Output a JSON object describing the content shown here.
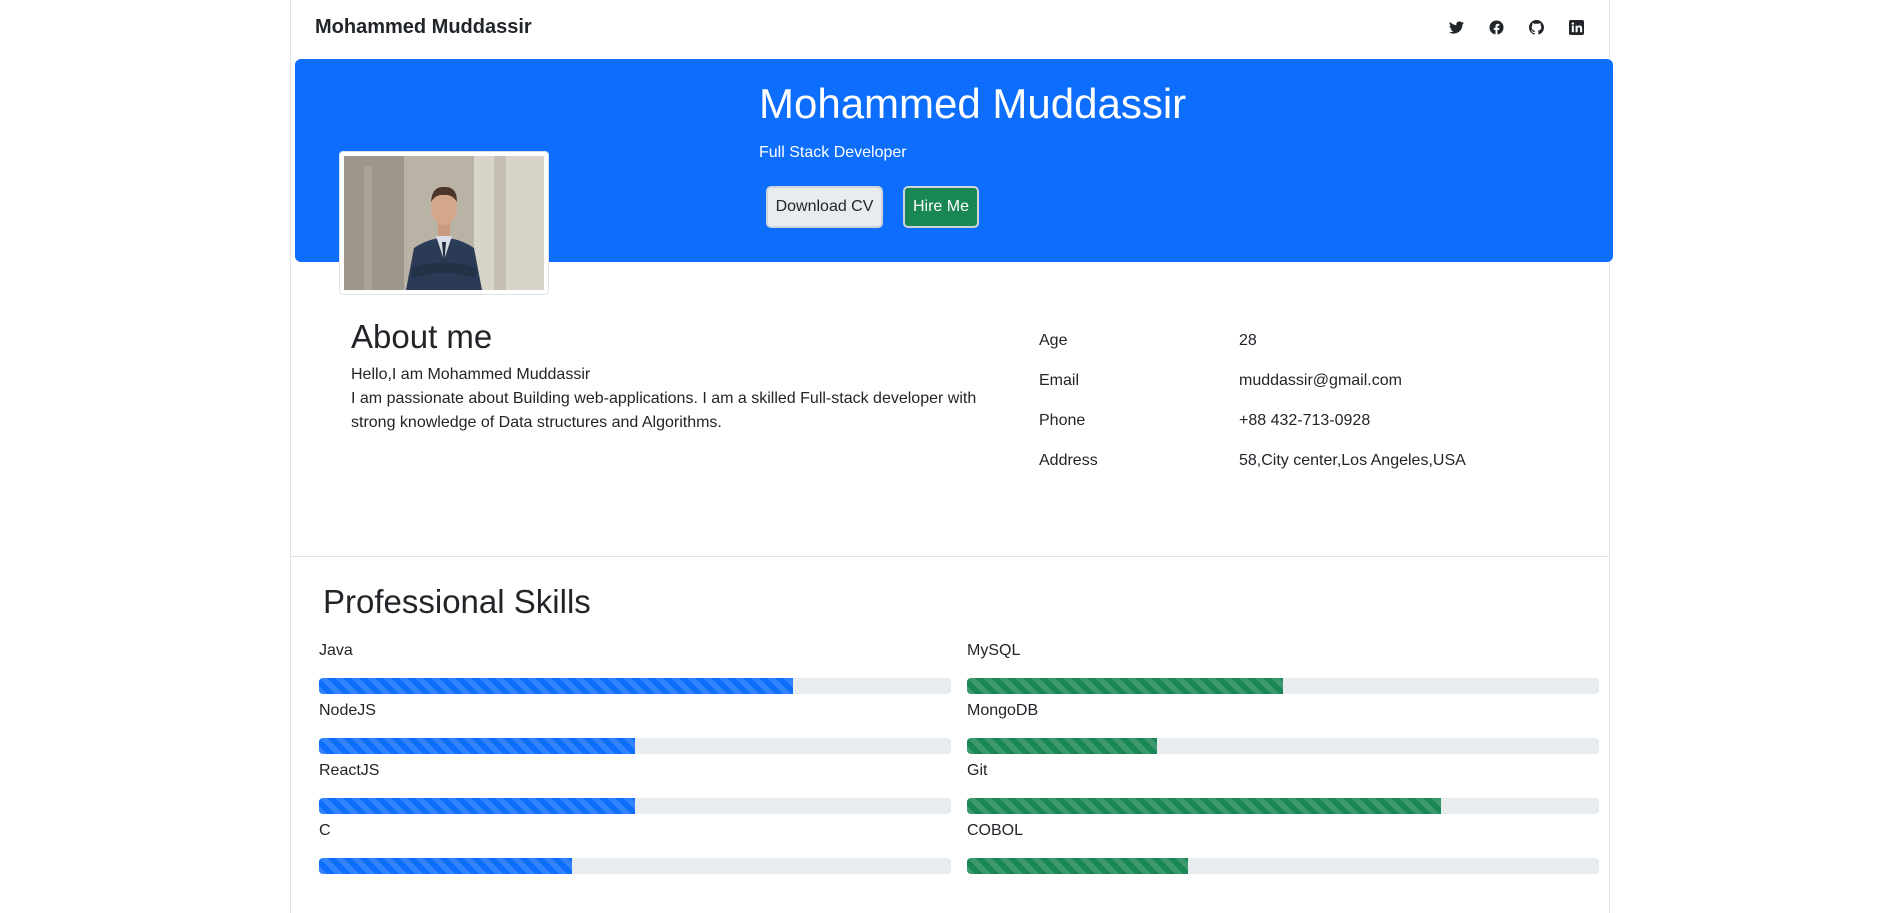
{
  "navbar": {
    "brand": "Mohammed Muddassir",
    "social_icons": [
      "twitter-icon",
      "facebook-icon",
      "github-icon",
      "linkedin-icon"
    ]
  },
  "hero": {
    "name": "Mohammed Muddassir",
    "role": "Full Stack Developer",
    "download_cv_label": "Download CV",
    "hire_me_label": "Hire Me"
  },
  "about": {
    "title": "About me",
    "greeting": "Hello,I am Mohammed Muddassir",
    "bio": "I am passionate about Building web-applications. I am a skilled Full-stack developer with strong knowledge of Data structures and Algorithms.",
    "info": [
      {
        "label": "Age",
        "value": "28"
      },
      {
        "label": "Email",
        "value": "muddassir@gmail.com"
      },
      {
        "label": "Phone",
        "value": "+88 432-713-0928"
      },
      {
        "label": "Address",
        "value": "58,City center,Los Angeles,USA"
      }
    ]
  },
  "skills": {
    "title": "Professional Skills",
    "left": [
      {
        "name": "Java",
        "level": 75
      },
      {
        "name": "NodeJS",
        "level": 50
      },
      {
        "name": "ReactJS",
        "level": 50
      },
      {
        "name": "C",
        "level": 40
      }
    ],
    "right": [
      {
        "name": "MySQL",
        "level": 50
      },
      {
        "name": "MongoDB",
        "level": 30
      },
      {
        "name": "Git",
        "level": 75
      },
      {
        "name": "COBOL",
        "level": 35
      }
    ]
  },
  "colors": {
    "primary": "#0d6efd",
    "success": "#198754",
    "bar_track": "#e9ecef"
  }
}
